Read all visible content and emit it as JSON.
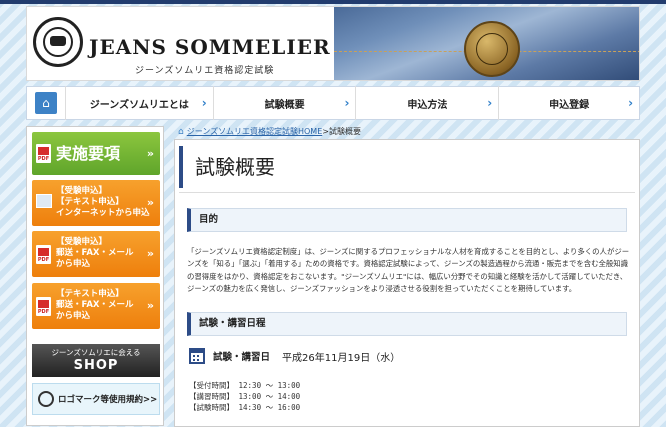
{
  "header": {
    "brand": "JEANS SOMMELIER",
    "brand_sub": "ジーンズソムリエ資格認定試験"
  },
  "nav": {
    "home_icon": "home-icon",
    "items": [
      {
        "label": "ジーンズソムリエとは"
      },
      {
        "label": "試験概要"
      },
      {
        "label": "申込方法"
      },
      {
        "label": "申込登録"
      }
    ]
  },
  "sidebar": {
    "guideline": "実施要項",
    "internet": {
      "line1": "【受験申込】",
      "line2": "【テキスト申込】",
      "line3": "インターネットから申込"
    },
    "exam_post": {
      "line1": "【受験申込】",
      "line2": "郵送・FAX・メール",
      "line3": "から申込"
    },
    "text_post": {
      "line1": "【テキスト申込】",
      "line2": "郵送・FAX・メール",
      "line3": "から申込"
    },
    "shop": {
      "small": "ジーンズソムリエに会える",
      "big": "SHOP"
    },
    "logomark": "ロゴマーク等使用規約>>"
  },
  "breadcrumb": {
    "home_link": "ジーンズソムリエ資格認定試験HOME",
    "current": ">試験概要"
  },
  "main": {
    "title": "試験概要",
    "section1": "目的",
    "purpose_text": "「ジーンズソムリエ資格認定制度」は、ジーンズに関するプロフェッショナルな人材を育成することを目的とし、より多くの人がジーンズを「知る」「選ぶ」「着用する」ための資格です。資格認定試験によって、ジーンズの製造過程から流通・販売までを含む全般知識の習得度をはかり、資格認定をおこないます。\"ジーンズソムリエ\"には、幅広い分野でその知識と経験を活かして活躍していただき、ジーンズの魅力を広く発信し、ジーンズファッションをより浸透させる役割を担っていただくことを期待しています。",
    "section2": "試験・講習日程",
    "date_label": "試験・講習日",
    "date_value": "平成26年11月19日（水）",
    "times": [
      "【受付時間】 12:30 ～ 13:00",
      "【講習時間】 13:00 ～ 14:00",
      "【試験時間】 14:30 ～ 16:00"
    ]
  },
  "colors": {
    "navy": "#2d4c87",
    "accent_blue": "#3d82c6",
    "green": "#6cb032",
    "orange": "#f28a14"
  }
}
